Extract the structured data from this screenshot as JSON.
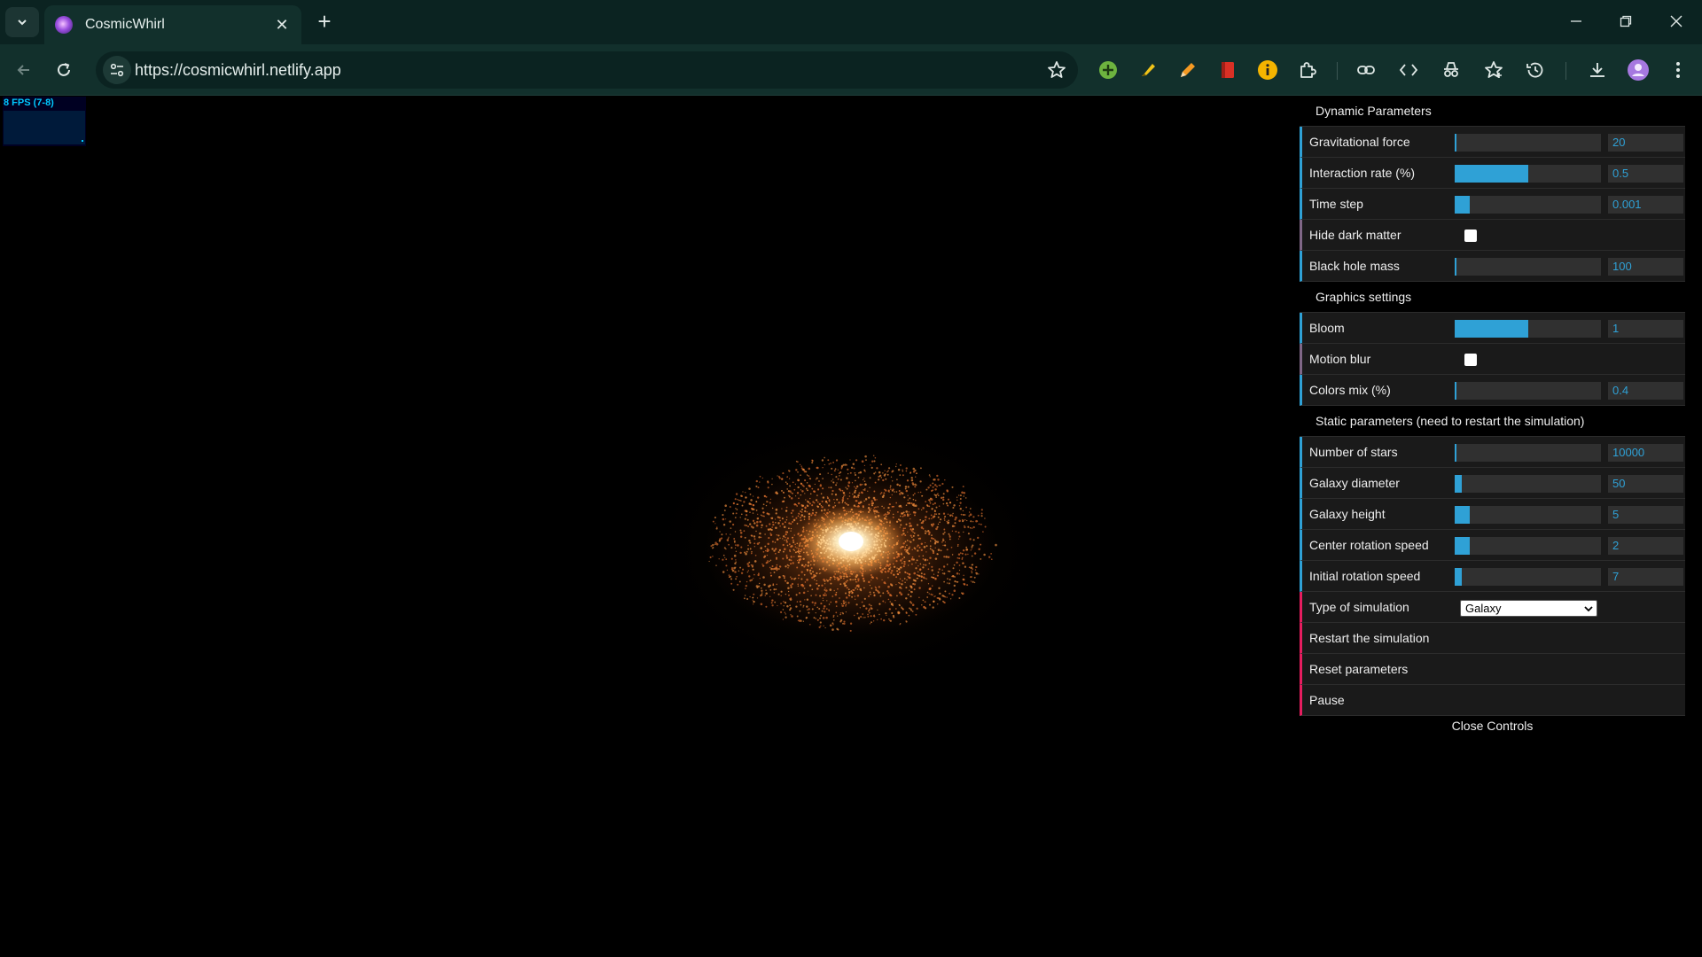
{
  "browser": {
    "tab_title": "CosmicWhirl",
    "url": "https://cosmicwhirl.netlify.app"
  },
  "stats": {
    "text": "8 FPS (7-8)"
  },
  "controls": {
    "sections": {
      "dynamic": "Dynamic Parameters",
      "graphics": "Graphics settings",
      "static": "Static parameters (need to restart the simulation)"
    },
    "rows": {
      "gravitational_force": {
        "label": "Gravitational force",
        "value": "20",
        "fill": 0.01
      },
      "interaction_rate": {
        "label": "Interaction rate (%)",
        "value": "0.5",
        "fill": 0.5
      },
      "time_step": {
        "label": "Time step",
        "value": "0.001",
        "fill": 0.1
      },
      "hide_dark_matter": {
        "label": "Hide dark matter",
        "checked": false
      },
      "black_hole_mass": {
        "label": "Black hole mass",
        "value": "100",
        "fill": 0.01
      },
      "bloom": {
        "label": "Bloom",
        "value": "1",
        "fill": 0.5
      },
      "motion_blur": {
        "label": "Motion blur",
        "checked": false
      },
      "colors_mix": {
        "label": "Colors mix (%)",
        "value": "0.4",
        "fill": 0.005
      },
      "number_of_stars": {
        "label": "Number of stars",
        "value": "10000",
        "fill": 0.01
      },
      "galaxy_diameter": {
        "label": "Galaxy diameter",
        "value": "50",
        "fill": 0.05
      },
      "galaxy_height": {
        "label": "Galaxy height",
        "value": "5",
        "fill": 0.1
      },
      "center_rotation_speed": {
        "label": "Center rotation speed",
        "value": "2",
        "fill": 0.1
      },
      "initial_rotation_speed": {
        "label": "Initial rotation speed",
        "value": "7",
        "fill": 0.05
      },
      "type_of_simulation": {
        "label": "Type of simulation",
        "value": "Galaxy"
      }
    },
    "buttons": {
      "restart": "Restart the simulation",
      "reset": "Reset parameters",
      "pause": "Pause"
    },
    "close": "Close Controls"
  },
  "colors": {
    "accent": "#2fa1d6",
    "function_accent": "#e61d5f",
    "boolean_accent": "#806787"
  }
}
